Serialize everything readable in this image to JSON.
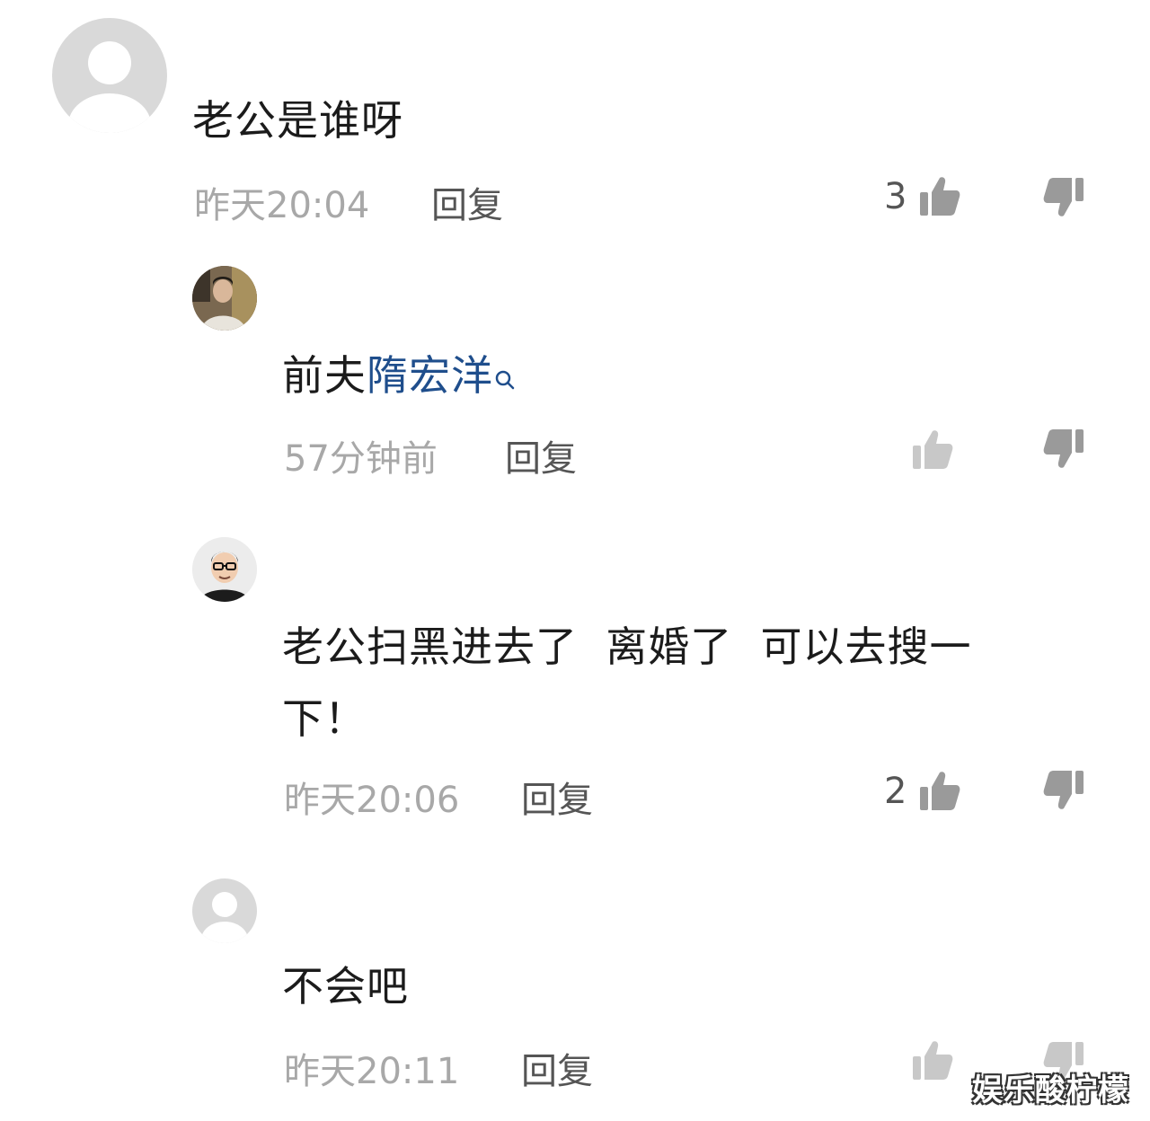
{
  "comments": [
    {
      "avatar": "default-avatar-icon",
      "text": "老公是谁呀",
      "time": "昨天20:04",
      "reply_label": "回复",
      "like_count": "3"
    },
    {
      "avatar": "photo-avatar-man",
      "text_prefix": "前夫",
      "text_link": "隋宏洋",
      "time": "57分钟前",
      "reply_label": "回复",
      "like_count": ""
    },
    {
      "avatar": "cartoon-avatar-glasses",
      "text_line1": "老公扫黑进去了  离婚了  可以去搜一",
      "text_line2": "下！",
      "time": "昨天20:06",
      "reply_label": "回复",
      "like_count": "2"
    },
    {
      "avatar": "default-avatar-icon",
      "text": "不会吧",
      "time": "昨天20:11",
      "reply_label": "回复",
      "like_count": ""
    }
  ],
  "watermark": "娱乐酸柠檬",
  "colors": {
    "link": "#1f4e8c",
    "time": "#a8a8a8",
    "reply": "#555555",
    "icon_grey": "#c8c8c8",
    "icon_dark": "#9a9a9a"
  }
}
